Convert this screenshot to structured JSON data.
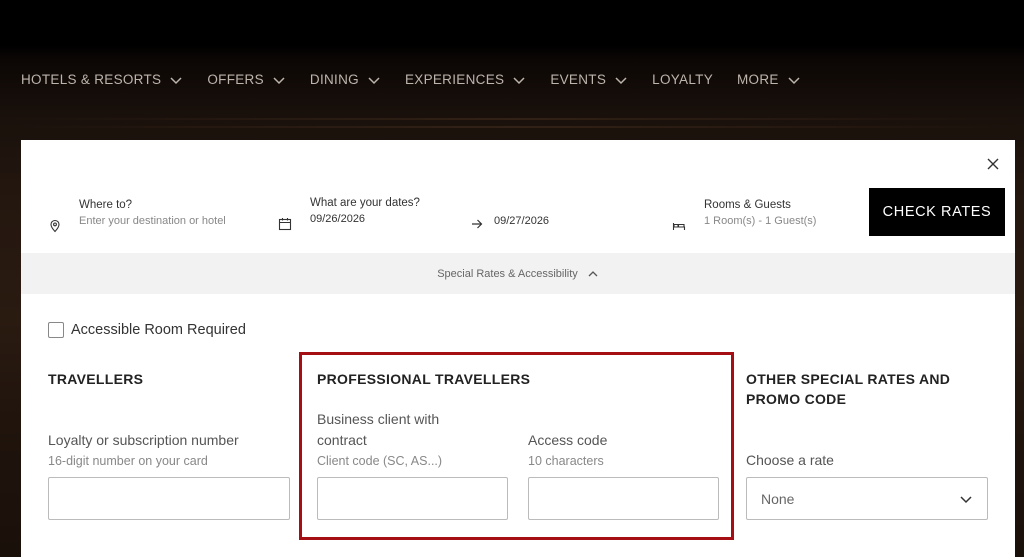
{
  "nav": {
    "items": [
      {
        "label": "HOTELS & RESORTS",
        "has_chevron": true
      },
      {
        "label": "OFFERS",
        "has_chevron": true
      },
      {
        "label": "DINING",
        "has_chevron": true
      },
      {
        "label": "EXPERIENCES",
        "has_chevron": true
      },
      {
        "label": "EVENTS",
        "has_chevron": true
      },
      {
        "label": "LOYALTY",
        "has_chevron": false
      },
      {
        "label": "MORE",
        "has_chevron": true
      }
    ]
  },
  "search": {
    "destination": {
      "label": "Where to?",
      "placeholder": "Enter your destination or hotel",
      "icon": "location-pin-icon"
    },
    "dates": {
      "label": "What are your dates?",
      "checkin": "09/26/2026",
      "checkout": "09/27/2026",
      "icon": "calendar-icon"
    },
    "rooms": {
      "label": "Rooms & Guests",
      "value": "1 Room(s) - 1 Guest(s)",
      "icon": "bed-icon"
    },
    "check_rates_label": "CHECK RATES"
  },
  "special": {
    "toggle_label": "Special Rates & Accessibility",
    "accessible_label": "Accessible Room Required",
    "accessible_checked": false
  },
  "travellers": {
    "title": "TRAVELLERS",
    "loyalty_label": "Loyalty or subscription number",
    "loyalty_hint": "16-digit number on your card",
    "loyalty_value": ""
  },
  "professional": {
    "title": "PROFESSIONAL TRAVELLERS",
    "client_label_line1": "Business client with",
    "client_label_line2": "contract",
    "client_hint": "Client code (SC, AS...)",
    "client_value": "",
    "access_label": "Access code",
    "access_hint": "10 characters",
    "access_value": ""
  },
  "other": {
    "title_line1": "OTHER SPECIAL RATES AND",
    "title_line2": "PROMO CODE",
    "rate_label": "Choose a rate",
    "rate_value": "None"
  },
  "colors": {
    "highlight": "#a50f14",
    "button_bg": "#000000",
    "nav_text": "#bdb4ac"
  }
}
